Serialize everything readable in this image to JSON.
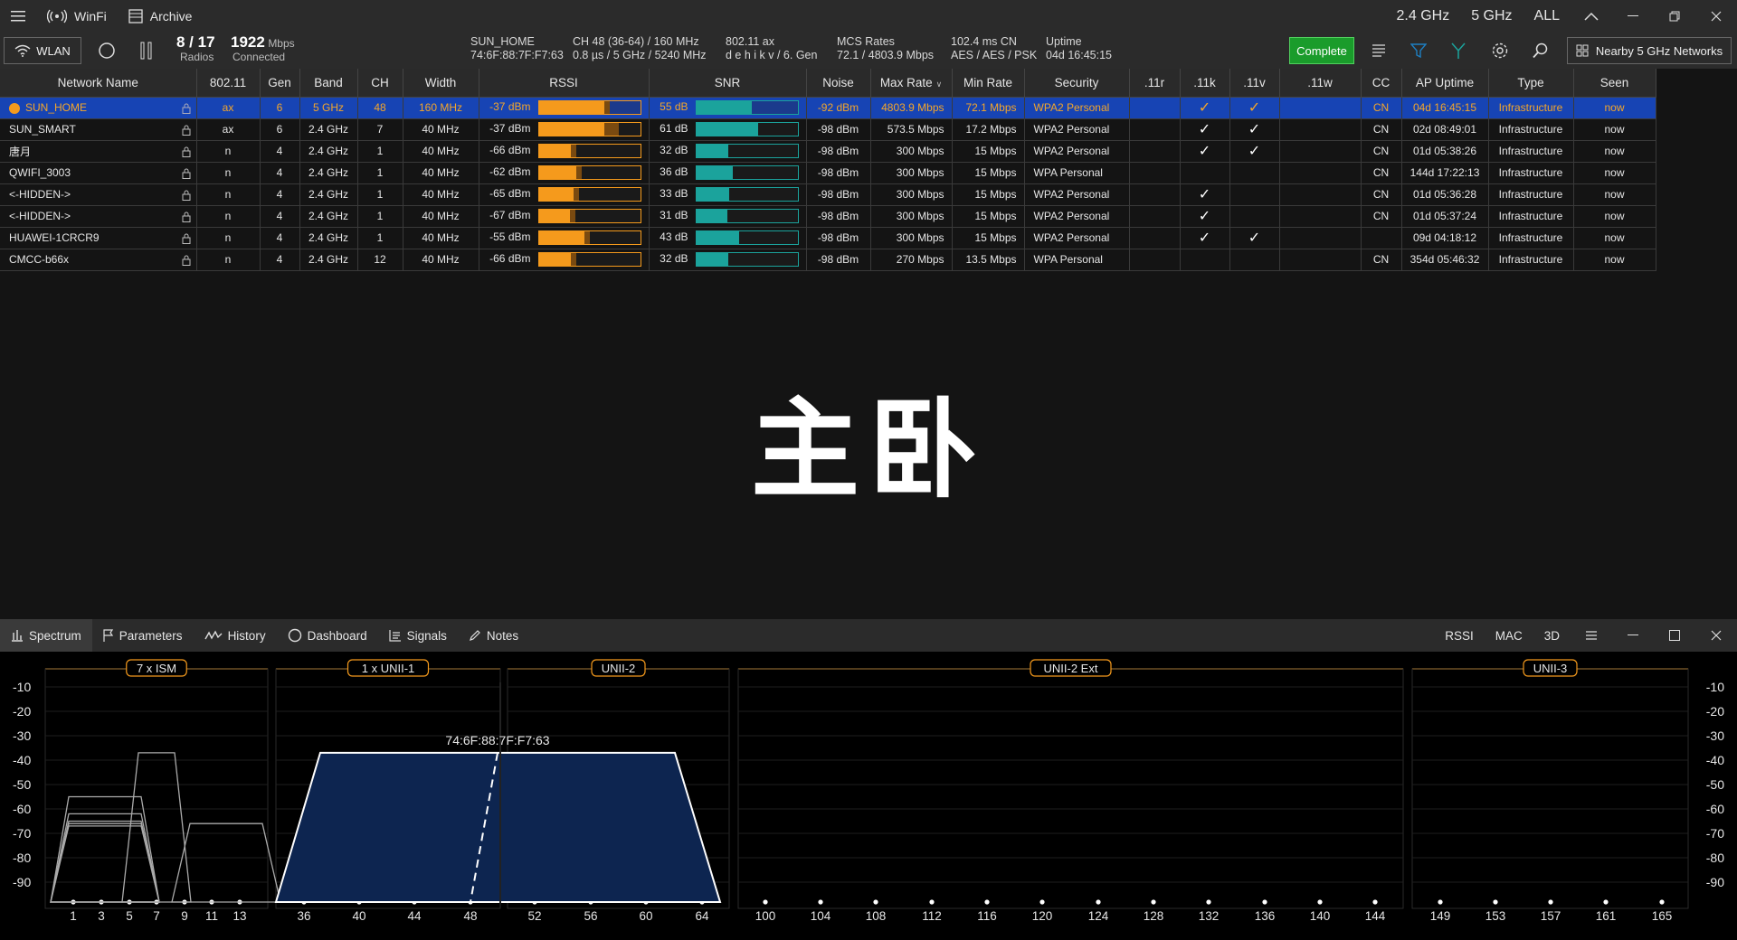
{
  "titlebar": {
    "app_name": "WinFi",
    "archive_label": "Archive",
    "band_24": "2.4 GHz",
    "band_5": "5 GHz",
    "band_all": "ALL"
  },
  "toolbar": {
    "wlan_label": "WLAN",
    "radios_count": "8 / 17",
    "radios_label": "Radios",
    "speed_value": "1922",
    "speed_unit": "Mbps",
    "speed_label": "Connected",
    "ssid": "SUN_HOME",
    "bssid": "74:6F:88:7F:F7:63",
    "channel_line1": "CH  48 (36-64)  /  160 MHz",
    "channel_line2": "0.8 µs / 5 GHz / 5240 MHz",
    "std_line1": "802.11 ax",
    "std_line2": "d  e h i k v / 6. Gen",
    "mcs_line1": "MCS Rates",
    "mcs_line2": "72.1 / 4803.9 Mbps",
    "latency_line1": "102.4 ms   CN",
    "latency_line2": "AES / AES / PSK",
    "uptime_line1": "Uptime",
    "uptime_line2": "04d 16:45:15",
    "complete_label": "Complete",
    "nearby_label": "Nearby 5 GHz Networks"
  },
  "table": {
    "headers": [
      "Network Name",
      "802.11",
      "Gen",
      "Band",
      "CH",
      "Width",
      "RSSI",
      "SNR",
      "Noise",
      "Max Rate",
      "Min Rate",
      "Security",
      ".11r",
      ".11k",
      ".11v",
      ".11w",
      "CC",
      "AP Uptime",
      "Type",
      "Seen"
    ],
    "rows": [
      {
        "name": "SUN_HOME",
        "std": "ax",
        "gen": "6",
        "band": "5 GHz",
        "ch": "48",
        "width": "160 MHz",
        "rssi": "-37 dBm",
        "rssi_pct": 0.65,
        "snr": "55 dB",
        "snr_pct": 0.55,
        "noise": "-92 dBm",
        "max": "4803.9 Mbps",
        "min": "72.1 Mbps",
        "sec": "WPA2 Personal",
        "r": "",
        "k": "✓",
        "v": "✓",
        "w": "",
        "cc": "CN",
        "uptime": "04d 16:45:15",
        "type": "Infrastructure",
        "seen": "now"
      },
      {
        "name": "SUN_SMART",
        "std": "ax",
        "gen": "6",
        "band": "2.4 GHz",
        "ch": "7",
        "width": "40 MHz",
        "rssi": "-37 dBm",
        "rssi_pct": 0.65,
        "snr": "61 dB",
        "snr_pct": 0.61,
        "noise": "-98 dBm",
        "max": "573.5 Mbps",
        "min": "17.2 Mbps",
        "sec": "WPA2 Personal",
        "r": "",
        "k": "✓",
        "v": "✓",
        "w": "",
        "cc": "CN",
        "uptime": "02d 08:49:01",
        "type": "Infrastructure",
        "seen": "now"
      },
      {
        "name": "唐月",
        "std": "n",
        "gen": "4",
        "band": "2.4 GHz",
        "ch": "1",
        "width": "40 MHz",
        "rssi": "-66 dBm",
        "rssi_pct": 0.32,
        "snr": "32 dB",
        "snr_pct": 0.32,
        "noise": "-98 dBm",
        "max": "300 Mbps",
        "min": "15 Mbps",
        "sec": "WPA2 Personal",
        "r": "",
        "k": "✓",
        "v": "✓",
        "w": "",
        "cc": "CN",
        "uptime": "01d 05:38:26",
        "type": "Infrastructure",
        "seen": "now"
      },
      {
        "name": "QWIFI_3003",
        "std": "n",
        "gen": "4",
        "band": "2.4 GHz",
        "ch": "1",
        "width": "40 MHz",
        "rssi": "-62 dBm",
        "rssi_pct": 0.37,
        "snr": "36 dB",
        "snr_pct": 0.36,
        "noise": "-98 dBm",
        "max": "300 Mbps",
        "min": "15 Mbps",
        "sec": "WPA Personal",
        "r": "",
        "k": "",
        "v": "",
        "w": "",
        "cc": "CN",
        "uptime": "144d 17:22:13",
        "type": "Infrastructure",
        "seen": "now"
      },
      {
        "name": "<-HIDDEN->",
        "std": "n",
        "gen": "4",
        "band": "2.4 GHz",
        "ch": "1",
        "width": "40 MHz",
        "rssi": "-65 dBm",
        "rssi_pct": 0.34,
        "snr": "33 dB",
        "snr_pct": 0.33,
        "noise": "-98 dBm",
        "max": "300 Mbps",
        "min": "15 Mbps",
        "sec": "WPA2 Personal",
        "r": "",
        "k": "✓",
        "v": "",
        "w": "",
        "cc": "CN",
        "uptime": "01d 05:36:28",
        "type": "Infrastructure",
        "seen": "now"
      },
      {
        "name": "<-HIDDEN->",
        "std": "n",
        "gen": "4",
        "band": "2.4 GHz",
        "ch": "1",
        "width": "40 MHz",
        "rssi": "-67 dBm",
        "rssi_pct": 0.31,
        "snr": "31 dB",
        "snr_pct": 0.31,
        "noise": "-98 dBm",
        "max": "300 Mbps",
        "min": "15 Mbps",
        "sec": "WPA2 Personal",
        "r": "",
        "k": "✓",
        "v": "",
        "w": "",
        "cc": "CN",
        "uptime": "01d 05:37:24",
        "type": "Infrastructure",
        "seen": "now"
      },
      {
        "name": "HUAWEI-1CRCR9",
        "std": "n",
        "gen": "4",
        "band": "2.4 GHz",
        "ch": "1",
        "width": "40 MHz",
        "rssi": "-55 dBm",
        "rssi_pct": 0.45,
        "snr": "43 dB",
        "snr_pct": 0.42,
        "noise": "-98 dBm",
        "max": "300 Mbps",
        "min": "15 Mbps",
        "sec": "WPA2 Personal",
        "r": "",
        "k": "✓",
        "v": "✓",
        "w": "",
        "cc": "",
        "uptime": "09d 04:18:12",
        "type": "Infrastructure",
        "seen": "now"
      },
      {
        "name": "CMCC-b66x",
        "std": "n",
        "gen": "4",
        "band": "2.4 GHz",
        "ch": "12",
        "width": "40 MHz",
        "rssi": "-66 dBm",
        "rssi_pct": 0.32,
        "snr": "32 dB",
        "snr_pct": 0.32,
        "noise": "-98 dBm",
        "max": "270 Mbps",
        "min": "13.5 Mbps",
        "sec": "WPA Personal",
        "r": "",
        "k": "",
        "v": "",
        "w": "",
        "cc": "CN",
        "uptime": "354d 05:46:32",
        "type": "Infrastructure",
        "seen": "now"
      }
    ]
  },
  "watermark": "主卧",
  "bottom_tabs": {
    "tabs": [
      "Spectrum",
      "Parameters",
      "History",
      "Dashboard",
      "Signals",
      "Notes"
    ],
    "right": [
      "RSSI",
      "MAC",
      "3D"
    ]
  },
  "spectrum": {
    "y_ticks": [
      "-10",
      "-20",
      "-30",
      "-40",
      "-50",
      "-60",
      "-70",
      "-80",
      "-90"
    ],
    "panels": [
      {
        "title": "7 x ISM",
        "labels": [
          "1",
          "3",
          "5",
          "7",
          "9",
          "11",
          "13"
        ]
      },
      {
        "title": "1 x UNII-1",
        "labels": [
          "36",
          "40",
          "44",
          "48"
        ]
      },
      {
        "title": "UNII-2",
        "labels": [
          "52",
          "56",
          "60",
          "64"
        ]
      },
      {
        "title": "UNII-2 Ext",
        "labels": [
          "100",
          "104",
          "108",
          "112",
          "116",
          "120",
          "124",
          "128",
          "132",
          "136",
          "140",
          "144"
        ]
      },
      {
        "title": "UNII-3",
        "labels": [
          "149",
          "153",
          "157",
          "161",
          "165"
        ]
      }
    ],
    "highlight_mac": "74:6F:88:7F:F7:63"
  },
  "colors": {
    "accent_orange": "#f59a1c",
    "select_blue": "#1744b4",
    "snr_teal": "#1ba39c",
    "complete_green": "#1a9c2b"
  }
}
